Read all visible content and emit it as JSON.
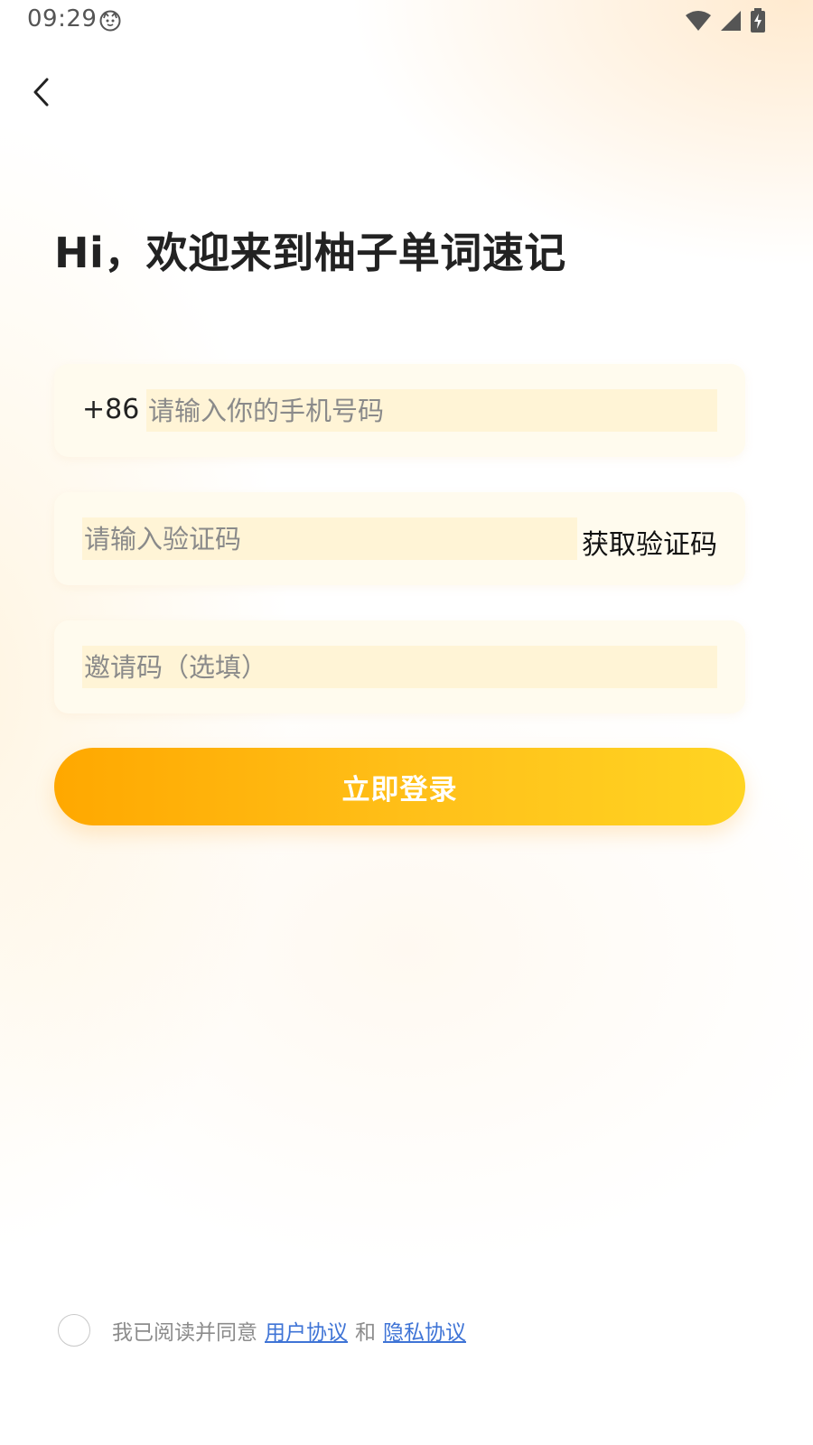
{
  "status_bar": {
    "time": "09:29",
    "icons": [
      "face-icon",
      "wifi-icon",
      "signal-icon",
      "battery-charging-icon"
    ]
  },
  "header": {
    "back_icon": "chevron-left-icon",
    "title": "Hi，欢迎来到柚子单词速记"
  },
  "form": {
    "phone": {
      "prefix": "+86",
      "placeholder": "请输入你的手机号码",
      "value": ""
    },
    "code": {
      "placeholder": "请输入验证码",
      "value": "",
      "action_label": "获取验证码"
    },
    "invite": {
      "placeholder": "邀请码（选填）",
      "value": ""
    },
    "submit_label": "立即登录"
  },
  "agreement": {
    "checked": false,
    "text": "我已阅读并同意",
    "user_agreement": "用户协议",
    "and": "和",
    "privacy_agreement": "隐私协议"
  },
  "colors": {
    "accent_start": "#ffa800",
    "accent_end": "#ffd422",
    "link": "#3f74d6",
    "field_bg": "#fffbee"
  }
}
